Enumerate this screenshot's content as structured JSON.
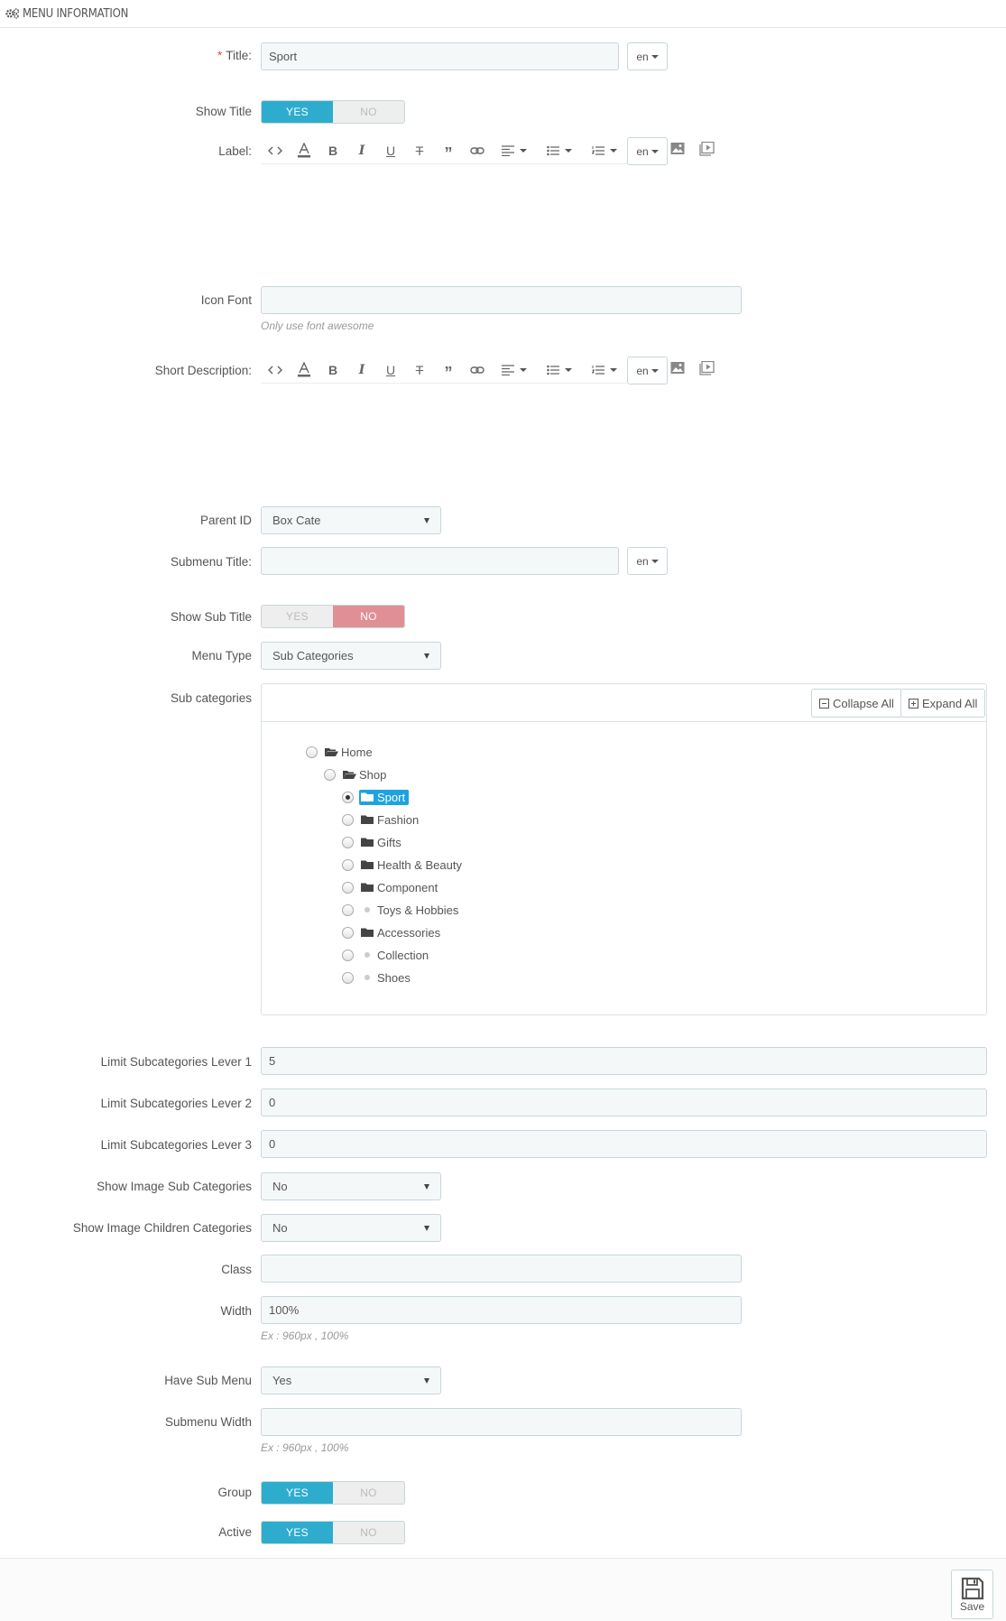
{
  "header": {
    "title": "MENU INFORMATION"
  },
  "fields": {
    "title": {
      "label": "Title:",
      "value": "Sport",
      "lang": "en"
    },
    "show_title": {
      "label": "Show Title",
      "yes": "YES",
      "no": "NO",
      "value": "YES"
    },
    "label_field": {
      "label": "Label:",
      "lang": "en"
    },
    "icon_font": {
      "label": "Icon Font",
      "value": "",
      "help": "Only use font awesome"
    },
    "short_description": {
      "label": "Short Description:",
      "lang": "en"
    },
    "parent_id": {
      "label": "Parent ID",
      "value": "Box Cate"
    },
    "submenu_title": {
      "label": "Submenu Title:",
      "value": "",
      "lang": "en"
    },
    "show_sub_title": {
      "label": "Show Sub Title",
      "yes": "YES",
      "no": "NO",
      "value": "NO"
    },
    "menu_type": {
      "label": "Menu Type",
      "value": "Sub Categories"
    },
    "sub_categories": {
      "label": "Sub categories",
      "collapse_all": "Collapse All",
      "expand_all": "Expand All"
    },
    "limit_lv1": {
      "label": "Limit Subcategories Lever 1",
      "value": "5"
    },
    "limit_lv2": {
      "label": "Limit Subcategories Lever 2",
      "value": "0"
    },
    "limit_lv3": {
      "label": "Limit Subcategories Lever 3",
      "value": "0"
    },
    "show_image_sub": {
      "label": "Show Image Sub Categories",
      "value": "No"
    },
    "show_image_children": {
      "label": "Show Image Children Categories",
      "value": "No"
    },
    "class_field": {
      "label": "Class",
      "value": ""
    },
    "width": {
      "label": "Width",
      "value": "100%",
      "help": "Ex : 960px , 100%"
    },
    "have_sub_menu": {
      "label": "Have Sub Menu",
      "value": "Yes"
    },
    "submenu_width": {
      "label": "Submenu Width",
      "value": "",
      "help": "Ex : 960px , 100%"
    },
    "group": {
      "label": "Group",
      "yes": "YES",
      "no": "NO",
      "value": "YES"
    },
    "active": {
      "label": "Active",
      "yes": "YES",
      "no": "NO",
      "value": "YES"
    }
  },
  "tree": [
    {
      "label": "Home",
      "icon": "folder-open-icon",
      "selected": false
    },
    {
      "label": "Shop",
      "icon": "folder-open-icon",
      "selected": false
    },
    {
      "label": "Sport",
      "icon": "folder-icon",
      "selected": true
    },
    {
      "label": "Fashion",
      "icon": "folder-icon",
      "selected": false
    },
    {
      "label": "Gifts",
      "icon": "folder-icon",
      "selected": false
    },
    {
      "label": "Health & Beauty",
      "icon": "folder-icon",
      "selected": false
    },
    {
      "label": "Component",
      "icon": "folder-icon",
      "selected": false
    },
    {
      "label": "Toys & Hobbies",
      "icon": "bullet-icon",
      "selected": false
    },
    {
      "label": "Accessories",
      "icon": "folder-icon",
      "selected": false
    },
    {
      "label": "Collection",
      "icon": "bullet-icon",
      "selected": false
    },
    {
      "label": "Shoes",
      "icon": "bullet-icon",
      "selected": false
    }
  ],
  "footer": {
    "save_label": "Save"
  },
  "colors": {
    "switch_yes": "#2eacce",
    "switch_no": "#e08f95",
    "tree_selected": "#1ea3e0",
    "required": "#e74c3c"
  }
}
